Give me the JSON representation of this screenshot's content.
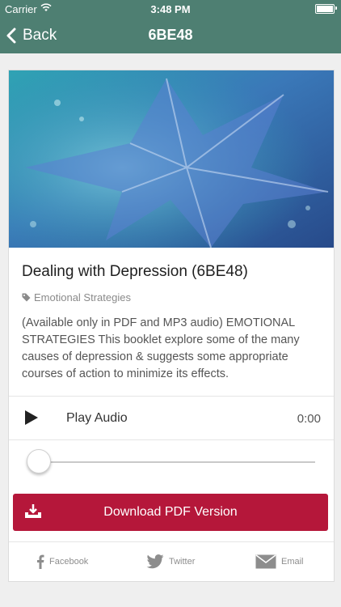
{
  "status_bar": {
    "carrier": "Carrier",
    "time": "3:48 PM"
  },
  "nav": {
    "back_label": "Back",
    "title": "6BE48"
  },
  "item": {
    "title": "Dealing with Depression (6BE48)",
    "category": "Emotional Strategies",
    "description": "(Available only in PDF and MP3 audio) EMOTIONAL STRATEGIES This booklet explore some of the many causes of depression & suggests some appropriate courses of action to minimize its effects."
  },
  "audio": {
    "play_label": "Play Audio",
    "time": "0:00",
    "progress": 0
  },
  "download": {
    "label": "Download PDF Version"
  },
  "share": {
    "facebook": "Facebook",
    "twitter": "Twitter",
    "email": "Email"
  },
  "colors": {
    "nav_bg": "#4e7f72",
    "download_bg": "#b5173a"
  },
  "icons": [
    "wifi-icon",
    "battery-icon",
    "chevron-left-icon",
    "tag-icon",
    "play-icon",
    "download-icon",
    "facebook-icon",
    "twitter-icon",
    "email-icon"
  ]
}
